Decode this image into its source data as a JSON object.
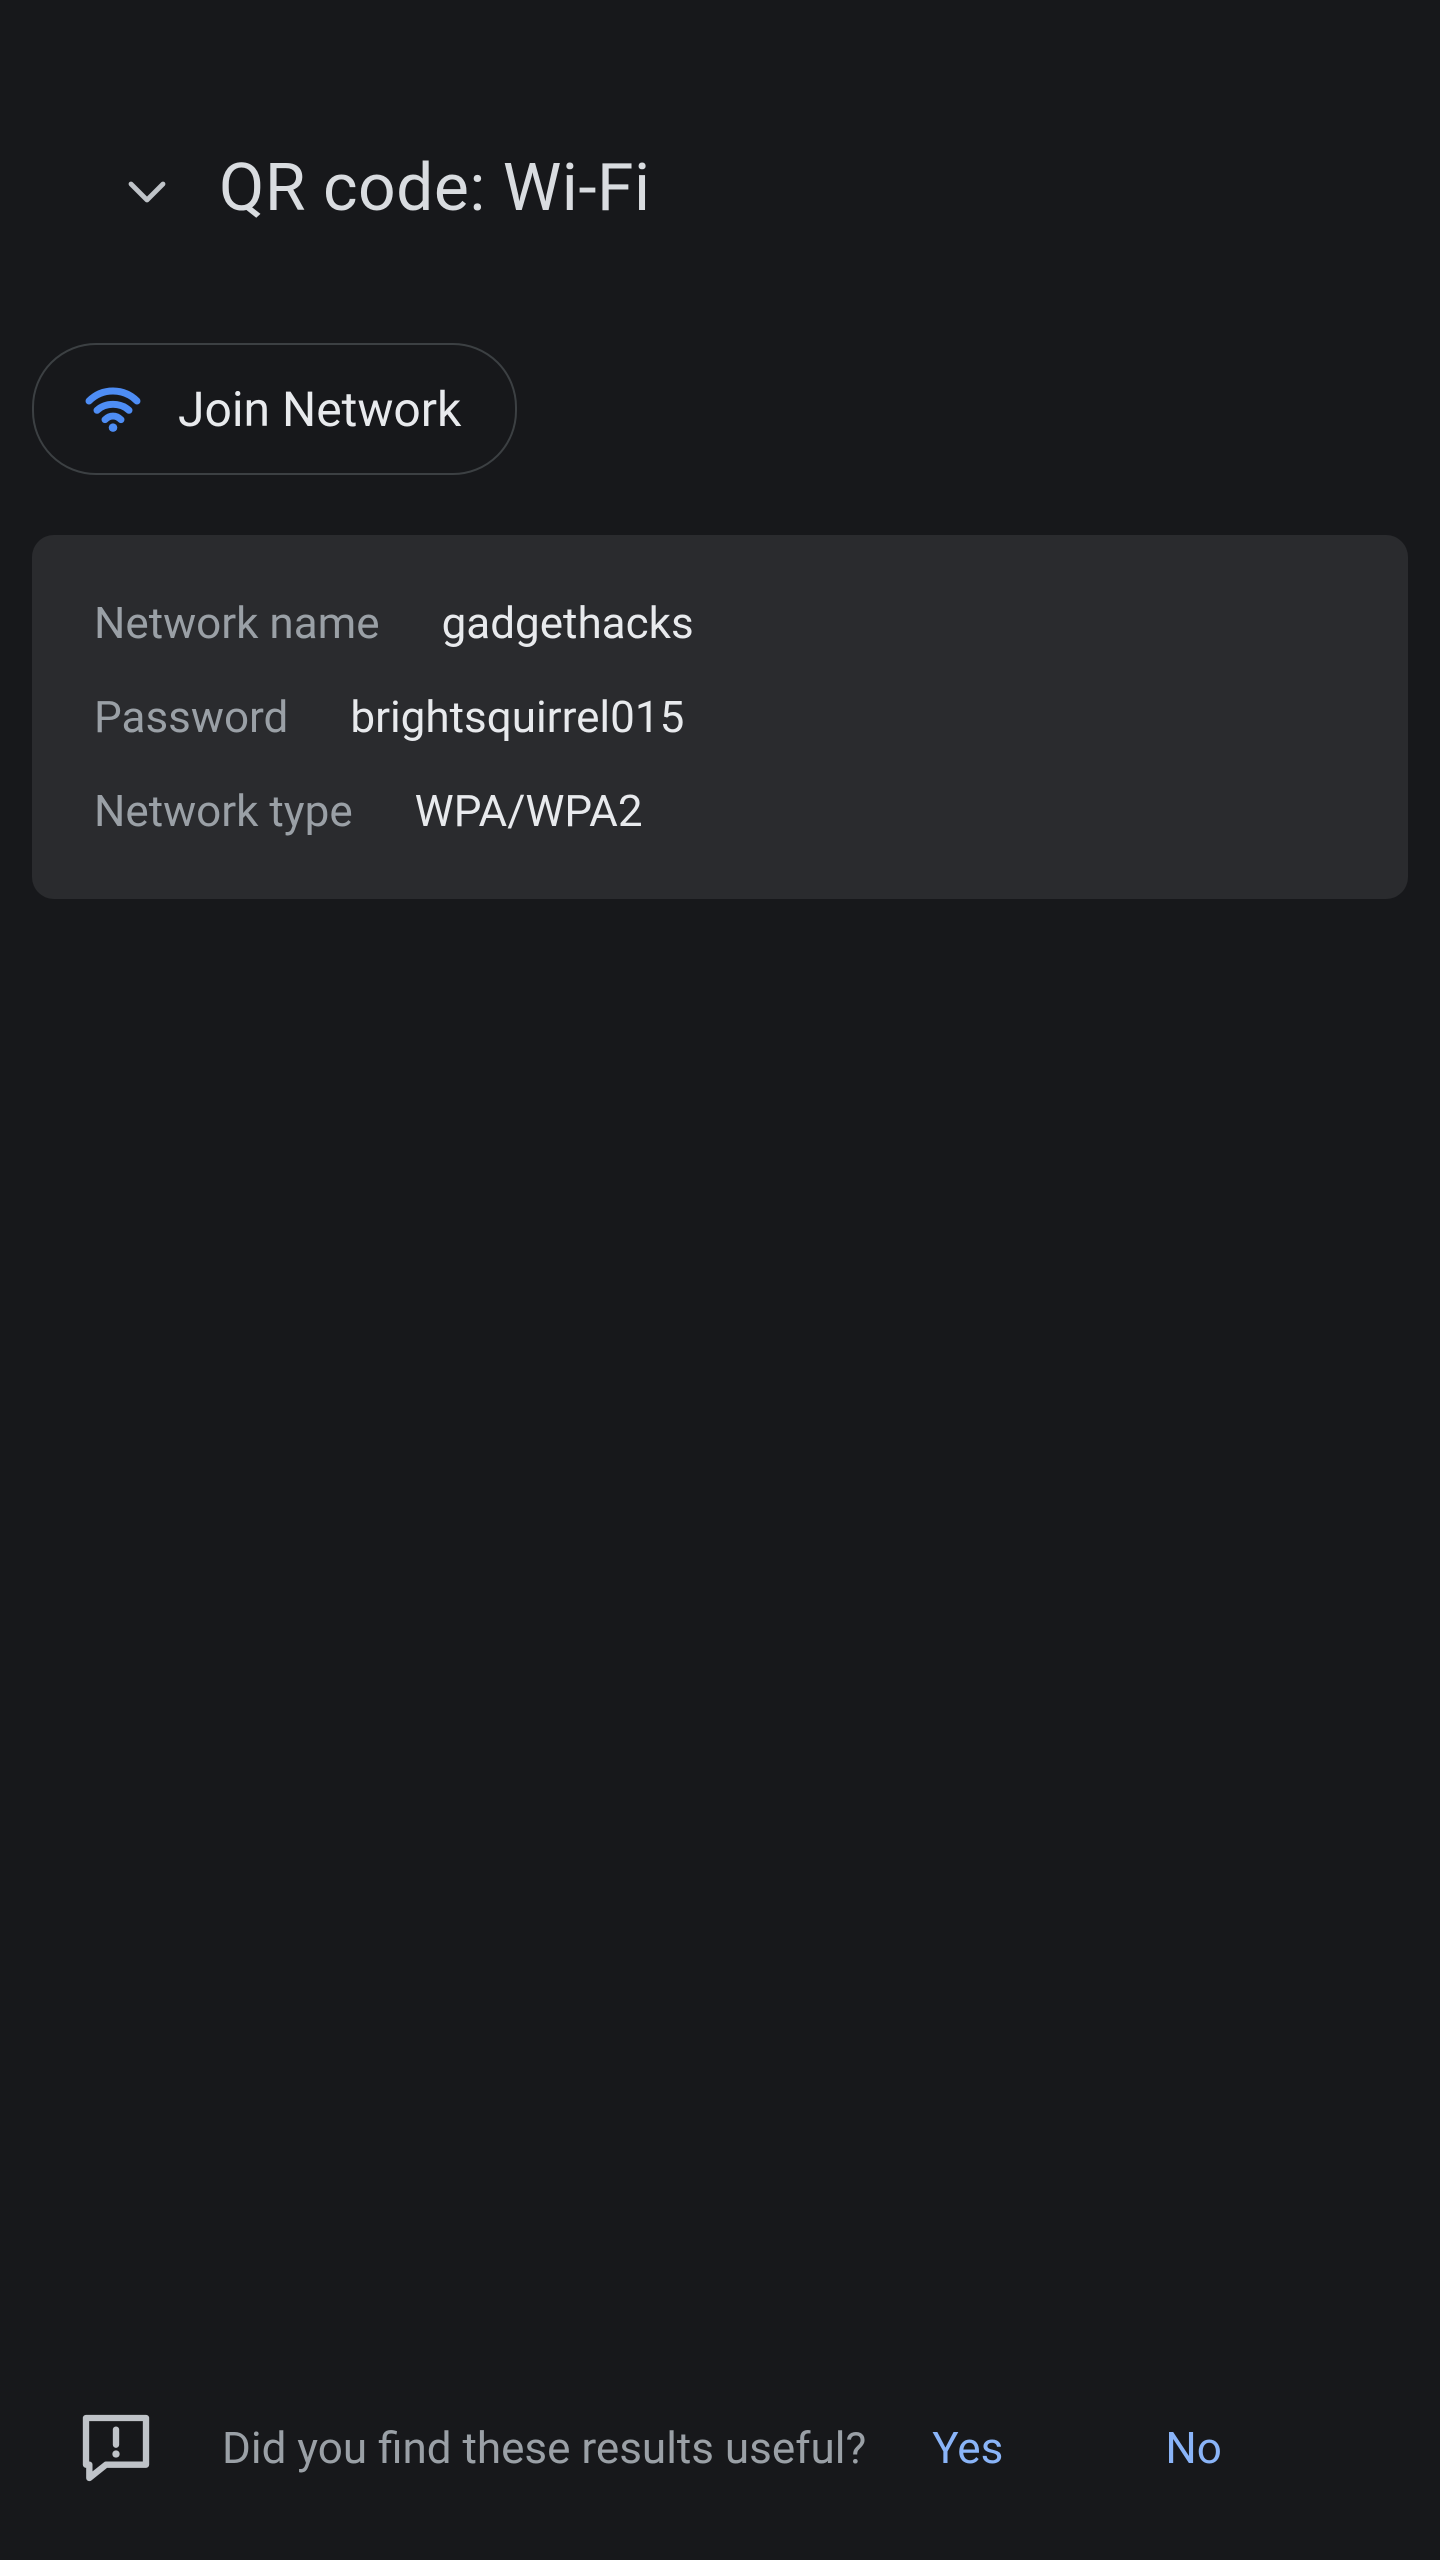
{
  "header": {
    "title": "QR code: Wi-Fi"
  },
  "chip": {
    "label": "Join Network"
  },
  "card": {
    "rows": [
      {
        "label": "Network name",
        "value": "gadgethacks"
      },
      {
        "label": "Password",
        "value": "brightsquirrel015"
      },
      {
        "label": "Network type",
        "value": "WPA/WPA2"
      }
    ]
  },
  "feedback": {
    "question": "Did you find these results useful?",
    "yes": "Yes",
    "no": "No"
  },
  "colors": {
    "accent": "#8ab4f8",
    "wifi_icon": "#4e8df5",
    "label": "#9aa0a6"
  }
}
